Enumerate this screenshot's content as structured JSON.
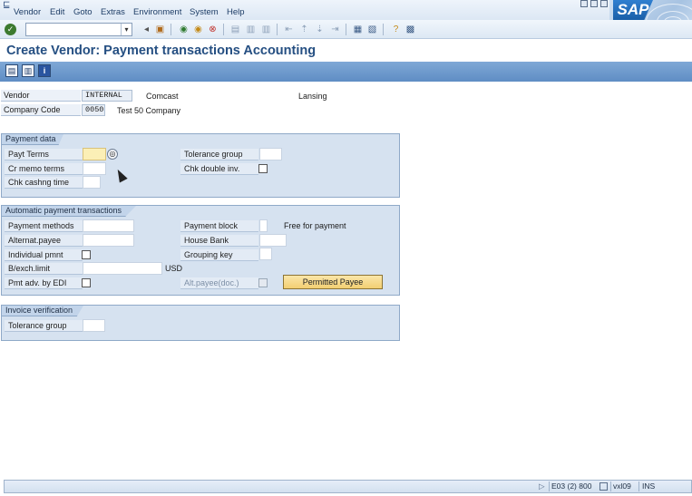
{
  "menubar": {
    "items": [
      "Vendor",
      "Edit",
      "Goto",
      "Extras",
      "Environment",
      "System",
      "Help"
    ],
    "logo": "SAP"
  },
  "toolbar": {
    "command_value": "",
    "icons": [
      "enter-icon",
      "back-icon",
      "save-icon",
      "back-arrow-icon",
      "exit-icon",
      "cancel-icon",
      "print-icon",
      "find-icon",
      "find-next-icon",
      "first-page-icon",
      "previous-page-icon",
      "next-page-icon",
      "last-page-icon",
      "create-session-icon",
      "shortcut-icon",
      "help-icon",
      "customize-layout-icon"
    ]
  },
  "title": "Create Vendor: Payment transactions Accounting",
  "app_toolbar": {
    "icons": [
      "administrative-data-icon",
      "previous-screen-icon",
      "info-icon"
    ]
  },
  "header": {
    "vendor_label": "Vendor",
    "vendor_value": "INTERNAL",
    "vendor_name": "Comcast",
    "vendor_city": "Lansing",
    "company_code_label": "Company Code",
    "company_code_value": "0050",
    "company_name": "Test 50 Company"
  },
  "payment_data": {
    "heading": "Payment data",
    "payt_terms_label": "Payt Terms",
    "payt_terms_value": "",
    "cr_memo_terms_label": "Cr memo terms",
    "chk_cashng_time_label": "Chk cashng time",
    "tolerance_group_label": "Tolerance group",
    "chk_double_inv_label": "Chk double inv.",
    "chk_double_inv_checked": false
  },
  "auto_payment": {
    "heading": "Automatic payment transactions",
    "payment_methods_label": "Payment methods",
    "alternat_payee_label": "Alternat.payee",
    "individual_pmnt_label": "Individual pmnt",
    "bexch_limit_label": "B/exch.limit",
    "bexch_currency": "USD",
    "pmt_adv_edi_label": "Pmt adv. by EDI",
    "payment_block_label": "Payment block",
    "payment_block_text": "Free for payment",
    "house_bank_label": "House Bank",
    "grouping_key_label": "Grouping key",
    "alt_payee_doc_label": "Alt.payee(doc.)",
    "permitted_payee_button": "Permitted Payee"
  },
  "invoice_verification": {
    "heading": "Invoice verification",
    "tolerance_group_label": "Tolerance group"
  },
  "statusbar": {
    "session": "E03 (2) 800",
    "server": "vxl09",
    "mode": "INS"
  }
}
